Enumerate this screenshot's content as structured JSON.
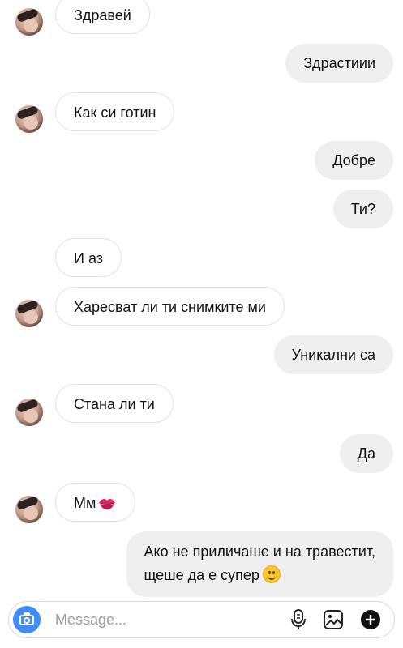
{
  "messages": [
    {
      "from": "them",
      "text": "Здравей"
    },
    {
      "from": "me",
      "text": "Здрастиии"
    },
    {
      "from": "them",
      "text": "Как си готин"
    },
    {
      "from": "me",
      "text": "Добре"
    },
    {
      "from": "me",
      "text": "Ти?"
    },
    {
      "from": "them",
      "text": "И аз"
    },
    {
      "from": "them",
      "text": "Харесват ли ти снимките ми"
    },
    {
      "from": "me",
      "text": "Уникални са"
    },
    {
      "from": "them",
      "text": "Стана ли ти"
    },
    {
      "from": "me",
      "text": "Да"
    },
    {
      "from": "them",
      "text": "Мм",
      "emoji": "kiss-mark"
    },
    {
      "from": "me",
      "line1": "Ако не приличаше и на травестит,",
      "line2": "щеше да е супер",
      "emoji": "slightly-smiling-face"
    }
  ],
  "composer": {
    "placeholder": "Message...",
    "icons": [
      "camera-icon",
      "microphone-icon",
      "gallery-icon",
      "plus-icon"
    ]
  },
  "colors": {
    "outgoing_bubble": "#efefef",
    "incoming_border": "#e3e3e3",
    "camera_button": "#3f8ef5"
  }
}
